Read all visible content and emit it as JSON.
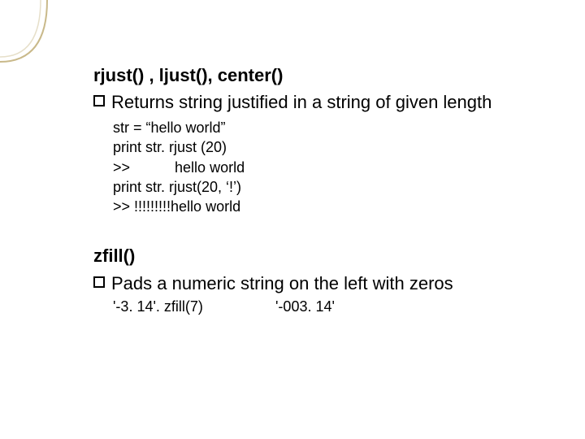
{
  "section1": {
    "title": "rjust() , ljust(), center()",
    "bullet": "Returns string justified in a string of given length",
    "code": "str = “hello world”\nprint str. rjust (20)\n>>           hello world\nprint str. rjust(20, ‘!’)\n>> !!!!!!!!!hello world"
  },
  "section2": {
    "title": "zfill()",
    "bullet": "Pads a numeric string on the left with zeros",
    "example_call": "'-3. 14'. zfill(7)",
    "example_result": "'-003. 14'"
  }
}
